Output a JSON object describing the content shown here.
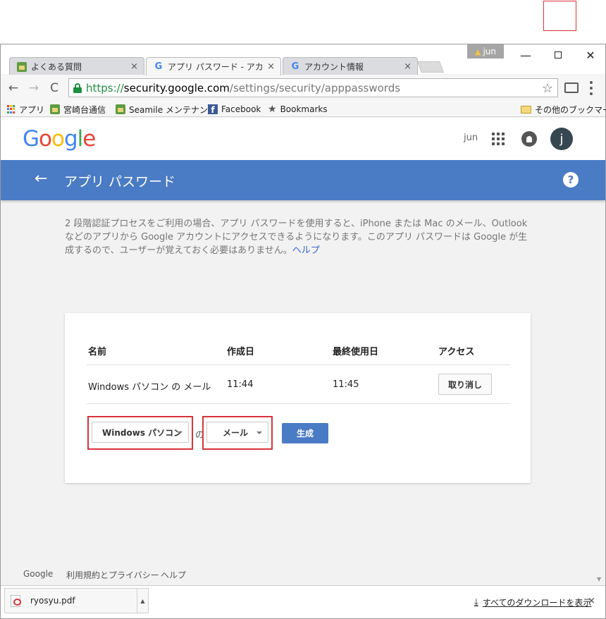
{
  "window": {
    "profile_name": "jun",
    "minimize": "—",
    "close": "✕"
  },
  "tabs": [
    {
      "title": "よくある質問",
      "close": "×"
    },
    {
      "title": "アプリ パスワード - アカウント設定",
      "close": "×"
    },
    {
      "title": "アカウント情報",
      "close": "×"
    }
  ],
  "toolbar": {
    "back": "←",
    "forward": "→",
    "reload": "C",
    "url_scheme": "https://",
    "url_host": "security.google.com",
    "url_path": "/settings/security/apppasswords",
    "star": "☆"
  },
  "bookmarks": {
    "apps": "アプリ",
    "items": [
      "宮崎台通信",
      "Seamile メンテナンス",
      "Facebook",
      "Bookmarks"
    ],
    "other": "その他のブックマーク"
  },
  "header": {
    "logo": [
      "G",
      "o",
      "o",
      "g",
      "l",
      "e"
    ],
    "user": "jun",
    "avatar_letter": "j"
  },
  "appbar": {
    "back_arrow": "←",
    "title": "アプリ パスワード",
    "help": "?"
  },
  "intro": {
    "text": "2 段階認証プロセスをご利用の場合、アプリ パスワードを使用すると、iPhone または Mac のメール、Outlook などのアプリから Google アカウントにアクセスできるようになります。このアプリ パスワードは Google が生成するので、ユーザーが覚えておく必要はありません。",
    "help_link": "ヘルプ"
  },
  "table": {
    "headers": {
      "name": "名前",
      "created": "作成日",
      "last_used": "最終使用日",
      "access": "アクセス"
    },
    "rows": [
      {
        "name": "Windows パソコン の メール",
        "created": "11:44",
        "last_used": "11:45",
        "action": "取り消し"
      }
    ]
  },
  "generator": {
    "device_select": "Windows パソコン",
    "of_label": "の",
    "app_select": "メール",
    "generate": "生成"
  },
  "footer": {
    "links": [
      "Google",
      "利用規約とプライバシー",
      "ヘルプ"
    ]
  },
  "downloads": {
    "file": "ryosyu.pdf",
    "show_all": "すべてのダウンロードを表示",
    "close": "×"
  },
  "colors": {
    "appbar": "#4a7bc5",
    "highlight": "#d9333a",
    "link": "#3367d6",
    "secure_green": "#1e8e3e",
    "logo_blue": "#4285f4",
    "logo_red": "#ea4335",
    "logo_yellow": "#fbbc05",
    "logo_green": "#34a853"
  }
}
